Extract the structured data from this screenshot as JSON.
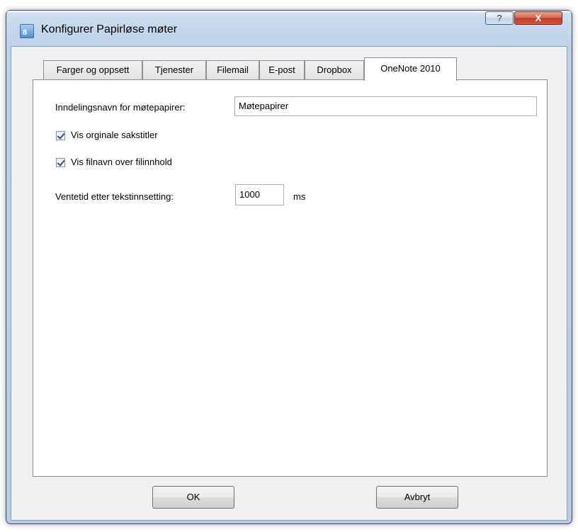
{
  "window": {
    "title": "Konfigurer Papirløse møter",
    "icon": "app-icon",
    "help_label": "?",
    "close_label": "X"
  },
  "tabs": [
    {
      "label": "Farger og oppsett",
      "active": false
    },
    {
      "label": "Tjenester",
      "active": false
    },
    {
      "label": "Filemail",
      "active": false
    },
    {
      "label": "E-post",
      "active": false
    },
    {
      "label": "Dropbox",
      "active": false
    },
    {
      "label": "OneNote 2010",
      "active": true
    }
  ],
  "onenote": {
    "section_name_label": "Inndelingsnavn for møtepapirer:",
    "section_name_value": "Møtepapirer",
    "show_original_titles": {
      "label": "Vis orginale sakstitler",
      "checked": true
    },
    "show_filename": {
      "label": "Vis filnavn over filinnhold",
      "checked": true
    },
    "wait_label": "Ventetid etter tekstinnsetting:",
    "wait_value": "1000",
    "wait_unit": "ms"
  },
  "buttons": {
    "ok_label": "OK",
    "cancel_label": "Avbryt"
  },
  "colors": {
    "frame": "#bdd1ea",
    "close_button": "#c13a25",
    "client_background": "#f0f0f0"
  }
}
